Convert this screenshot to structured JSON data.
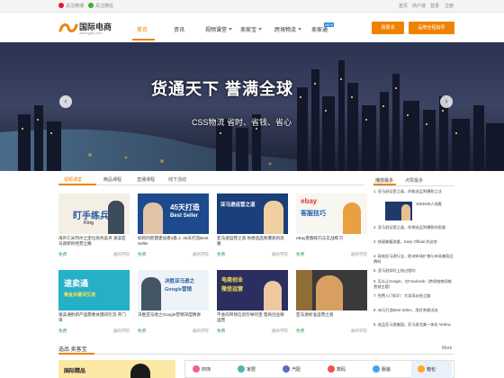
{
  "topbar": {
    "weibo": "关注微博",
    "wechat": "关注微信",
    "right_links": [
      "首页",
      "商户端",
      "登录",
      "注册"
    ]
  },
  "logo": {
    "name": "国际电商",
    "domain": "www.gjds.com"
  },
  "nav": {
    "items": [
      "首页",
      "资讯",
      "视频课堂",
      "卖家宝",
      "跨境物流",
      "卖家通"
    ],
    "active_index": 0,
    "new_badge": "NEW",
    "btn_left": "我要求",
    "btn_right": "品牌全程指导"
  },
  "banner": {
    "title": "货通天下 誉满全球",
    "subtitle": "CSS物流 省时、省钱、省心",
    "prev_icon": "‹",
    "next_icon": "›"
  },
  "video_section": {
    "tabs": [
      "视频课堂",
      "精品课程",
      "直播课程",
      "线下活动"
    ],
    "active_tab": 0,
    "cards_row1": [
      {
        "title": "海外仁米列尔之定位商务卖点 速卖亚马逊新的经营之路",
        "free": "免费",
        "source": "通商学院",
        "img_text": "盯手练兵",
        "img_label": "King"
      },
      {
        "title": "如何的智慧建设者2类 2. 45天打造Best Seller",
        "free": "免费",
        "source": "通商学院",
        "img_text": "45天打造",
        "img_label": "Best Seller"
      },
      {
        "title": "亚马逊运营之道 你想选品到爆款的思路",
        "free": "免费",
        "source": "通商学院",
        "img_text": "亚马逊运营之道",
        "img_label": "亚马逊"
      },
      {
        "title": "eBay客服技巧与实战练习",
        "free": "免费",
        "source": "通商学院",
        "img_text": "ebay",
        "img_label": "客服技巧"
      }
    ],
    "cards_row2": [
      {
        "title": "速卖通别新产品需要关键词引流 开门单",
        "free": "免费",
        "source": "通商学院",
        "img_text": "速卖通",
        "img_label": "黄金关键词引流"
      },
      {
        "title": "决胜亚马逊之Google营销深度精讲",
        "free": "免费",
        "source": "通商学院",
        "img_text": "决胜亚马逊之",
        "img_label": "Google营销"
      },
      {
        "title": "不会的带领信息引导的宝 电商创业微运营",
        "free": "免费",
        "source": "通商学院",
        "img_text": "电商创业",
        "img_label": "微信运营"
      },
      {
        "title": "亚马逊标准运营之道",
        "free": "免费",
        "source": "通商学院",
        "img_text": "",
        "img_label": ""
      }
    ]
  },
  "ranking": {
    "tabs": [
      "播放最多",
      "点赞最多"
    ],
    "active_tab": 0,
    "items": [
      "2. 亚马逊运营之道，你想选品到爆款的思路",
      "3. 快速掌握流量，Easy Official 的这些",
      "4. 高效亚马逊行业，欧洲市场扩增与市场兼容品牌的",
      "5. 亚马逊实时上线过程的",
      "6. 怎么让Google、在Facebook（跨境电商网络营销主题）",
      "7. 免费入门知识：大卖家必经之路",
      "8. 45万打造Best Seller，用好关键词选",
      "9. 选品亚马逊美国，亚马逊北美一体化 Vertica"
    ],
    "top_item": "1. 亚马逊运营之道，你能选品到爆款之法",
    "top_meta": "1654646人观看"
  },
  "picks": {
    "title": "选品 卖客宝",
    "more": "More",
    "categories": [
      "商饰",
      "家居",
      "汽配",
      "数码",
      "服装",
      "箱包"
    ],
    "active_category": 4,
    "img_text": "国际精品"
  },
  "colors": {
    "accent": "#f08200",
    "free_green": "#2e9e4a",
    "rank_red": "#e64a19"
  }
}
